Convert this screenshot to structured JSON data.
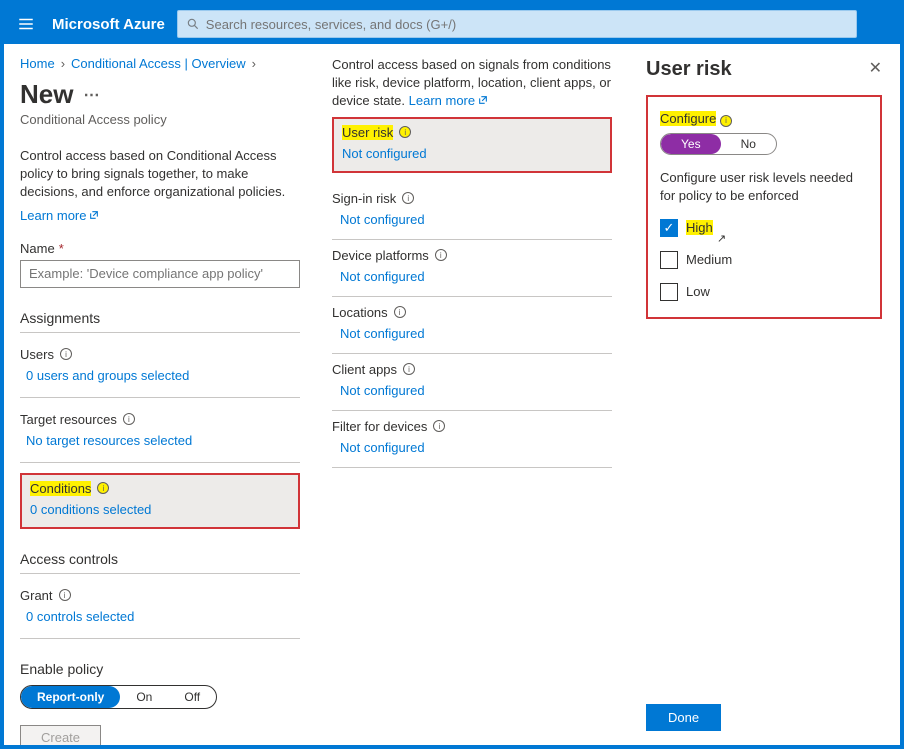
{
  "header": {
    "brand": "Microsoft Azure",
    "search_placeholder": "Search resources, services, and docs (G+/)"
  },
  "breadcrumb": {
    "home": "Home",
    "ca": "Conditional Access | Overview"
  },
  "page": {
    "title": "New",
    "subtitle": "Conditional Access policy",
    "desc": "Control access based on Conditional Access policy to bring signals together, to make decisions, and enforce organizational policies.",
    "learn": "Learn more",
    "name_label": "Name",
    "name_placeholder": "Example: 'Device compliance app policy'"
  },
  "sections": {
    "assignments": "Assignments",
    "access_controls": "Access controls"
  },
  "assign": {
    "users_label": "Users",
    "users_val": "0 users and groups selected",
    "target_label": "Target resources",
    "target_val": "No target resources selected",
    "cond_label": "Conditions",
    "cond_val": "0 conditions selected"
  },
  "controls": {
    "grant_label": "Grant",
    "grant_val": "0 controls selected"
  },
  "enable": {
    "label": "Enable policy",
    "report": "Report-only",
    "on": "On",
    "off": "Off"
  },
  "create": "Create",
  "conditions_col": {
    "desc": "Control access based on signals from conditions like risk, device platform, location, client apps, or device state.",
    "learn": "Learn more",
    "user_risk": "User risk",
    "user_risk_val": "Not configured",
    "signin_risk": "Sign-in risk",
    "signin_risk_val": "Not configured",
    "device_platforms": "Device platforms",
    "device_platforms_val": "Not configured",
    "locations": "Locations",
    "locations_val": "Not configured",
    "client_apps": "Client apps",
    "client_apps_val": "Not configured",
    "filter": "Filter for devices",
    "filter_val": "Not configured"
  },
  "panel": {
    "title": "User risk",
    "configure": "Configure",
    "yes": "Yes",
    "no": "No",
    "desc": "Configure user risk levels needed for policy to be enforced",
    "high": "High",
    "medium": "Medium",
    "low": "Low",
    "done": "Done"
  }
}
